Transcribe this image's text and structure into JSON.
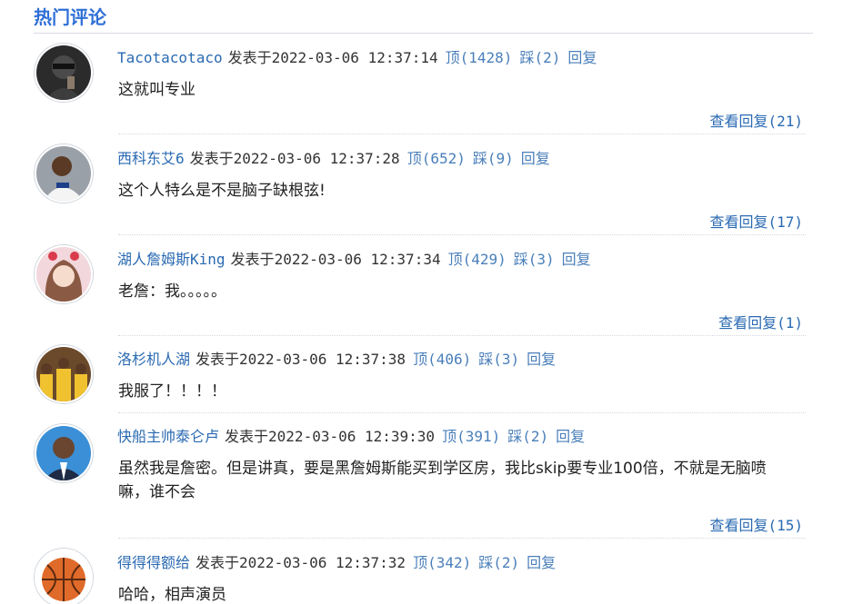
{
  "section": {
    "title": "热门评论"
  },
  "comments": [
    {
      "username": "Tacotacotaco",
      "published_label": "发表于",
      "timestamp": "2022-03-06 12:37:14",
      "like_label": "顶(1428)",
      "dislike_label": "踩(2)",
      "reply_label": "回复",
      "text": "这就叫专业",
      "view_replies_label": "查看回复(21)"
    },
    {
      "username": "西科东艾6",
      "published_label": "发表于",
      "timestamp": "2022-03-06 12:37:28",
      "like_label": "顶(652)",
      "dislike_label": "踩(9)",
      "reply_label": "回复",
      "text": "这个人特么是不是脑子缺根弦!",
      "view_replies_label": "查看回复(17)"
    },
    {
      "username": "湖人詹姆斯King",
      "published_label": "发表于",
      "timestamp": "2022-03-06 12:37:34",
      "like_label": "顶(429)",
      "dislike_label": "踩(3)",
      "reply_label": "回复",
      "text": "老詹：我。。。。。",
      "view_replies_label": "查看回复(1)"
    },
    {
      "username": "洛杉机人湖",
      "published_label": "发表于",
      "timestamp": "2022-03-06 12:37:38",
      "like_label": "顶(406)",
      "dislike_label": "踩(3)",
      "reply_label": "回复",
      "text": "我服了！！！！",
      "view_replies_label": ""
    },
    {
      "username": "快船主帅泰仑卢",
      "published_label": "发表于",
      "timestamp": "2022-03-06 12:39:30",
      "like_label": "顶(391)",
      "dislike_label": "踩(2)",
      "reply_label": "回复",
      "text": "虽然我是詹密。但是讲真，要是黑詹姆斯能买到学区房，我比skip要专业100倍，不就是无脑喷嘛，谁不会",
      "view_replies_label": "查看回复(15)"
    },
    {
      "username": "得得得额给",
      "published_label": "发表于",
      "timestamp": "2022-03-06 12:37:32",
      "like_label": "顶(342)",
      "dislike_label": "踩(2)",
      "reply_label": "回复",
      "text": "哈哈，相声演员",
      "view_replies_label": ""
    }
  ],
  "avatars": [
    {
      "icon": "avatar-masked-person-icon",
      "bg": "#2b2b2b"
    },
    {
      "icon": "avatar-basketball-player-icon",
      "bg": "#9aa0a8"
    },
    {
      "icon": "avatar-girl-bunny-ears-icon",
      "bg": "#f2d7dc"
    },
    {
      "icon": "avatar-team-celebration-icon",
      "bg": "#6b4a2b"
    },
    {
      "icon": "avatar-coach-suit-icon",
      "bg": "#3a8fd6"
    },
    {
      "icon": "avatar-basketball-ball-icon",
      "bg": "#e06a2a"
    }
  ],
  "colors": {
    "title": "#2e6fd6",
    "link": "#2a6ab2",
    "action": "#4a7fba",
    "text": "#222222"
  }
}
